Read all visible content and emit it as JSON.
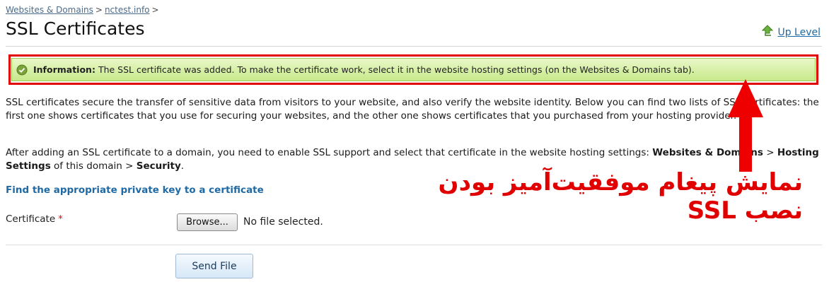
{
  "breadcrumb": {
    "items": [
      "Websites & Domains",
      "nctest.info"
    ],
    "separator": ">"
  },
  "page": {
    "title": "SSL Certificates",
    "up_level": "Up Level"
  },
  "message": {
    "label": "Information:",
    "text": "The SSL certificate was added. To make the certificate work, select it in the website hosting settings (on the Websites & Domains tab)."
  },
  "content": {
    "para1": "SSL certificates secure the transfer of sensitive data from visitors to your website, and also verify the website identity. Below you can find two lists of SSL certificates: the first one shows certificates that you use for securing your websites, and the other one shows certificates that you purchased from your hosting provider.",
    "para2_text": "After adding an SSL certificate to a domain, you need to enable SSL support and select that certificate in the website hosting settings: ",
    "para2_b1": "Websites & Domains",
    "para2_sep1": " > ",
    "para2_b2": "Hosting Settings",
    "para2_mid": " of this domain > ",
    "para2_b3": "Security",
    "para2_end": ".",
    "private_key_link": "Find the appropriate private key to a certificate"
  },
  "form": {
    "certificate_label": "Certificate",
    "required_marker": "*",
    "browse_label": "Browse...",
    "file_status": "No file selected.",
    "send_label": "Send File"
  },
  "annotation": {
    "text": "نمایش پیغام موفقیت‌آمیز بودن نصب SSL",
    "color": "#e00000"
  },
  "icons": {
    "up_level": "up-arrow-icon",
    "info": "check-circle-icon"
  }
}
